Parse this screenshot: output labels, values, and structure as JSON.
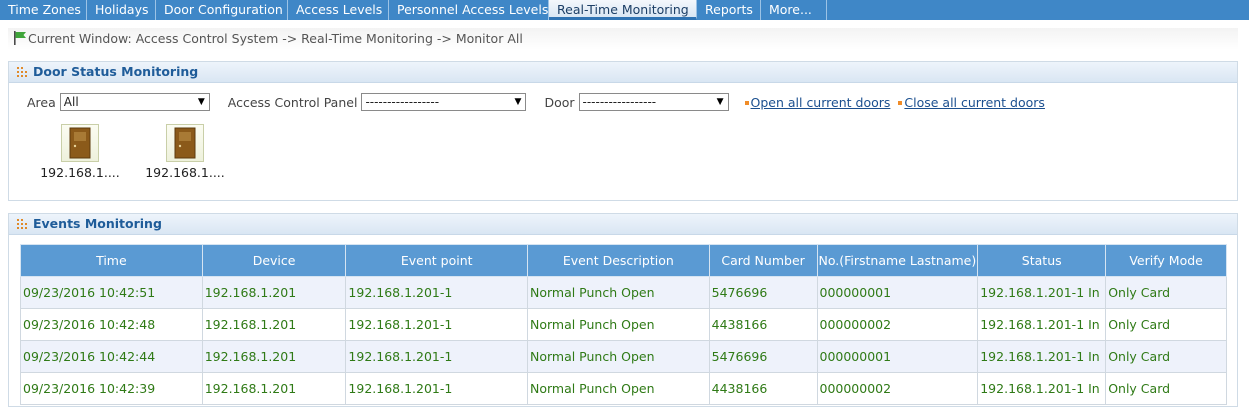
{
  "nav": {
    "tabs": [
      {
        "label": "Time Zones"
      },
      {
        "label": "Holidays"
      },
      {
        "label": "Door Configuration"
      },
      {
        "label": "Access Levels"
      },
      {
        "label": "Personnel Access Levels"
      },
      {
        "label": "Real-Time Monitoring"
      },
      {
        "label": "Reports"
      },
      {
        "label": "More..."
      }
    ],
    "active_index": 5
  },
  "breadcrumb": {
    "text": "Current Window: Access Control System -> Real-Time Monitoring -> Monitor All"
  },
  "door_panel": {
    "title": "Door Status Monitoring",
    "area_label": "Area",
    "area_value": "All",
    "acp_label": "Access Control Panel",
    "acp_value": "-----------------",
    "door_label": "Door",
    "door_value": "-----------------",
    "open_all": "Open all current doors",
    "close_all": "Close all current doors",
    "doors": [
      {
        "label": "192.168.1...."
      },
      {
        "label": "192.168.1...."
      }
    ]
  },
  "events_panel": {
    "title": "Events Monitoring",
    "columns": [
      "Time",
      "Device",
      "Event point",
      "Event Description",
      "Card Number",
      "No.(Firstname Lastname)",
      "Status",
      "Verify Mode"
    ],
    "rows": [
      [
        "09/23/2016 10:42:51",
        "192.168.1.201",
        "192.168.1.201-1",
        "Normal Punch Open",
        "5476696",
        "000000001",
        "192.168.1.201-1 In",
        "Only Card"
      ],
      [
        "09/23/2016 10:42:48",
        "192.168.1.201",
        "192.168.1.201-1",
        "Normal Punch Open",
        "4438166",
        "000000002",
        "192.168.1.201-1 In",
        "Only Card"
      ],
      [
        "09/23/2016 10:42:44",
        "192.168.1.201",
        "192.168.1.201-1",
        "Normal Punch Open",
        "5476696",
        "000000001",
        "192.168.1.201-1 In",
        "Only Card"
      ],
      [
        "09/23/2016 10:42:39",
        "192.168.1.201",
        "192.168.1.201-1",
        "Normal Punch Open",
        "4438166",
        "000000002",
        "192.168.1.201-1 In",
        "Only Card"
      ]
    ]
  },
  "colors": {
    "nav_bg": "#3f87c7",
    "header_text": "#1f5c99",
    "table_header": "#5a9ad3",
    "event_text": "#2f7a16"
  }
}
